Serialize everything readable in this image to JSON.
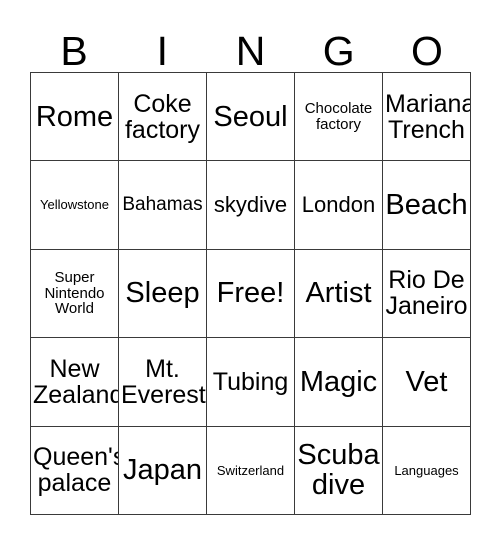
{
  "card": {
    "header": {
      "letters": [
        "B",
        "I",
        "N",
        "G",
        "O"
      ]
    },
    "rows": [
      [
        {
          "text": "Rome",
          "size": "xxl"
        },
        {
          "text": "Coke\nfactory",
          "size": "xl"
        },
        {
          "text": "Seoul",
          "size": "xxl"
        },
        {
          "text": "Chocolate\nfactory",
          "size": "sm"
        },
        {
          "text": "Mariana\nTrench",
          "size": "xl"
        }
      ],
      [
        {
          "text": "Yellowstone",
          "size": "xs"
        },
        {
          "text": "Bahamas",
          "size": "md"
        },
        {
          "text": "skydive",
          "size": "lg"
        },
        {
          "text": "London",
          "size": "lg"
        },
        {
          "text": "Beach",
          "size": "xxl"
        }
      ],
      [
        {
          "text": "Super\nNintendo\nWorld",
          "size": "sm"
        },
        {
          "text": "Sleep",
          "size": "xxl"
        },
        {
          "text": "Free!",
          "size": "xxl"
        },
        {
          "text": "Artist",
          "size": "xxl"
        },
        {
          "text": "Rio De\nJaneiro",
          "size": "xl"
        }
      ],
      [
        {
          "text": "New\nZealand",
          "size": "xl"
        },
        {
          "text": "Mt.\nEverest",
          "size": "xl"
        },
        {
          "text": "Tubing",
          "size": "xl"
        },
        {
          "text": "Magic",
          "size": "xxl"
        },
        {
          "text": "Vet",
          "size": "xxl"
        }
      ],
      [
        {
          "text": "Queen's\npalace",
          "size": "xl"
        },
        {
          "text": "Japan",
          "size": "xxl"
        },
        {
          "text": "Switzerland",
          "size": "xs"
        },
        {
          "text": "Scuba\ndive",
          "size": "xxl"
        },
        {
          "text": "Languages",
          "size": "xs"
        }
      ]
    ],
    "free_space": {
      "row": 2,
      "col": 2,
      "label": "Free!"
    },
    "colors": {
      "background": "#ffffff",
      "text": "#000000",
      "grid_line": "#3a3a3a"
    }
  }
}
